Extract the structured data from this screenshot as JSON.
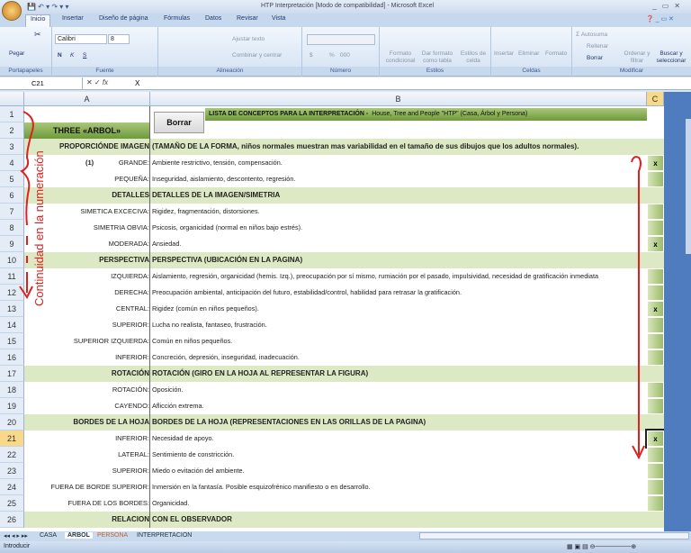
{
  "window": {
    "title": "HTP Interpretación  [Modo de compatibilidad] - Microsoft Excel",
    "controls": [
      "_",
      "▭",
      "✕"
    ]
  },
  "ribbon_tabs": [
    "Inicio",
    "Insertar",
    "Diseño de página",
    "Fórmulas",
    "Datos",
    "Revisar",
    "Vista"
  ],
  "ribbon": {
    "clipboard": {
      "paste": "Pegar",
      "label": "Portapapeles"
    },
    "font": {
      "name": "Calibri",
      "size": "8",
      "bold": "N",
      "italic": "K",
      "underline": "S",
      "label": "Fuente"
    },
    "alignment": {
      "wrap": "Ajustar texto",
      "merge": "Combinar y centrar",
      "label": "Alineación"
    },
    "number": {
      "currency": "$",
      "percent": "%",
      "thousands": "000",
      "label": "Número"
    },
    "styles": {
      "conditional": "Formato condicional",
      "table": "Dar formato como tabla",
      "cell": "Estilos de celda",
      "label": "Estilos"
    },
    "cells": {
      "insert": "Insertar",
      "delete": "Eliminar",
      "format": "Formato",
      "label": "Celdas"
    },
    "editing": {
      "autosum": "Autosuma",
      "fill": "Rellenar",
      "clear": "Borrar",
      "sort": "Ordenar y filtrar",
      "find": "Buscar y seleccionar",
      "label": "Modificar"
    }
  },
  "formula_bar": {
    "name_box": "C21",
    "value": "X"
  },
  "columns": [
    "A",
    "B",
    "C"
  ],
  "sheet": {
    "title_a": "THREE  «ARBOL»",
    "borrar_button": "Borrar",
    "header_b": "LISTA DE CONCEPTOS PARA LA INTERPRETACIÓN  -",
    "header_b_sub": "House, Tree and People \"HTP\" (Casa, Árbol y Persona)",
    "rows": [
      {
        "n": "3",
        "type": "hdr",
        "a": "PROPORCIÓNDE IMAGEN",
        "b": "(TAMAÑO DE LA FORMA, niños normales muestran mas variabilidad en el tamaño de sus dibujos que los adultos normales).",
        "c": ""
      },
      {
        "n": "4",
        "type": "item",
        "a": "GRANDE:",
        "a_num": "(1)",
        "b": "Ambiente restrictivo, tensión, compensación.",
        "c": "x"
      },
      {
        "n": "5",
        "type": "item",
        "a": "PEQUEÑA:",
        "b": "Inseguridad, aislamiento, descontento, regresión.",
        "c": ""
      },
      {
        "n": "6",
        "type": "hdr",
        "a": "DETALLES",
        "b": "DETALLES DE LA IMAGEN/SIMETRIA",
        "c": ""
      },
      {
        "n": "7",
        "type": "item",
        "a": "SIMETICA EXCECIVA:",
        "b": "Rigidez, fragmentación, distorsiones.",
        "c": ""
      },
      {
        "n": "8",
        "type": "item",
        "a": "SIMETRIA OBVIA:",
        "b": "Psicosis, organicidad (normal en niños bajo estrés).",
        "c": ""
      },
      {
        "n": "9",
        "type": "item",
        "a": "MODERADA:",
        "b": "Ansiedad.",
        "c": "x"
      },
      {
        "n": "10",
        "type": "hdr",
        "a": "PERSPECTIVA",
        "b": "PERSPECTIVA (UBICACIÓN EN LA PAGINA)",
        "c": ""
      },
      {
        "n": "11",
        "type": "item",
        "a": "IZQUIERDA:",
        "b": "Aislamiento, regresión, organicidad (hemis. Izq.), preocupación por sí mismo, rumiación por el pasado, impulsividad, necesidad de gratificación inmediata",
        "c": ""
      },
      {
        "n": "12",
        "type": "item",
        "a": "DERECHA:",
        "b": "Preocupación ambiental, anticipación del futuro, estabilidad/control, habilidad para retrasar la gratificación.",
        "c": ""
      },
      {
        "n": "13",
        "type": "item",
        "a": "CENTRAL:",
        "b": "Rigidez (común en niños pequeños).",
        "c": "x"
      },
      {
        "n": "14",
        "type": "item",
        "a": "SUPERIOR:",
        "b": "Lucha no realista, fantaseo, frustración.",
        "c": ""
      },
      {
        "n": "15",
        "type": "item",
        "a": "SUPERIOR IZQUIERDA:",
        "b": "Común en niños pequeños.",
        "c": ""
      },
      {
        "n": "16",
        "type": "item",
        "a": "INFERIOR:",
        "b": "Concreción, depresión, inseguridad, inadecuación.",
        "c": ""
      },
      {
        "n": "17",
        "type": "hdr",
        "a": "ROTACIÓN",
        "b": "ROTACIÓN (GIRO EN LA HOJA AL REPRESENTAR LA FIGURA)",
        "c": ""
      },
      {
        "n": "18",
        "type": "item",
        "a": "ROTACIÓN:",
        "b": "Oposición.",
        "c": ""
      },
      {
        "n": "19",
        "type": "item",
        "a": "CAYENDO:",
        "b": "Aflicción extrema.",
        "c": ""
      },
      {
        "n": "20",
        "type": "hdr",
        "a": "BORDES DE LA HOJA",
        "b": "BORDES DE LA HOJA (REPRESENTACIONES EN LAS ORILLAS DE LA PAGINA)",
        "c": ""
      },
      {
        "n": "21",
        "type": "item",
        "a": "INFERIOR:",
        "b": "Necesidad de apoyo.",
        "c": "x",
        "selected": true
      },
      {
        "n": "22",
        "type": "item",
        "a": "LATERAL:",
        "b": "Sentimiento de constricción.",
        "c": ""
      },
      {
        "n": "23",
        "type": "item",
        "a": "SUPERIOR:",
        "b": "Miedo o evitación del ambiente.",
        "c": ""
      },
      {
        "n": "24",
        "type": "item",
        "a": "FUERA DE BORDE SUPERIOR:",
        "b": "Inmersión en la fantasía.  Posible esquizofrénico manifiesto o en desarrollo.",
        "c": ""
      },
      {
        "n": "25",
        "type": "item",
        "a": "FUERA DE LOS BORDES:",
        "b": "Organicidad.",
        "c": ""
      },
      {
        "n": "26",
        "type": "hdr",
        "a": "RELACION",
        "b": "CON EL OBSERVADOR",
        "c": ""
      }
    ]
  },
  "annotation": "Continuidad en la numeración",
  "sheet_tabs": [
    "CASA",
    "ARBOL",
    "PERSONA",
    "INTERPRETACION"
  ],
  "active_sheet": "ARBOL",
  "status": "Introducir"
}
